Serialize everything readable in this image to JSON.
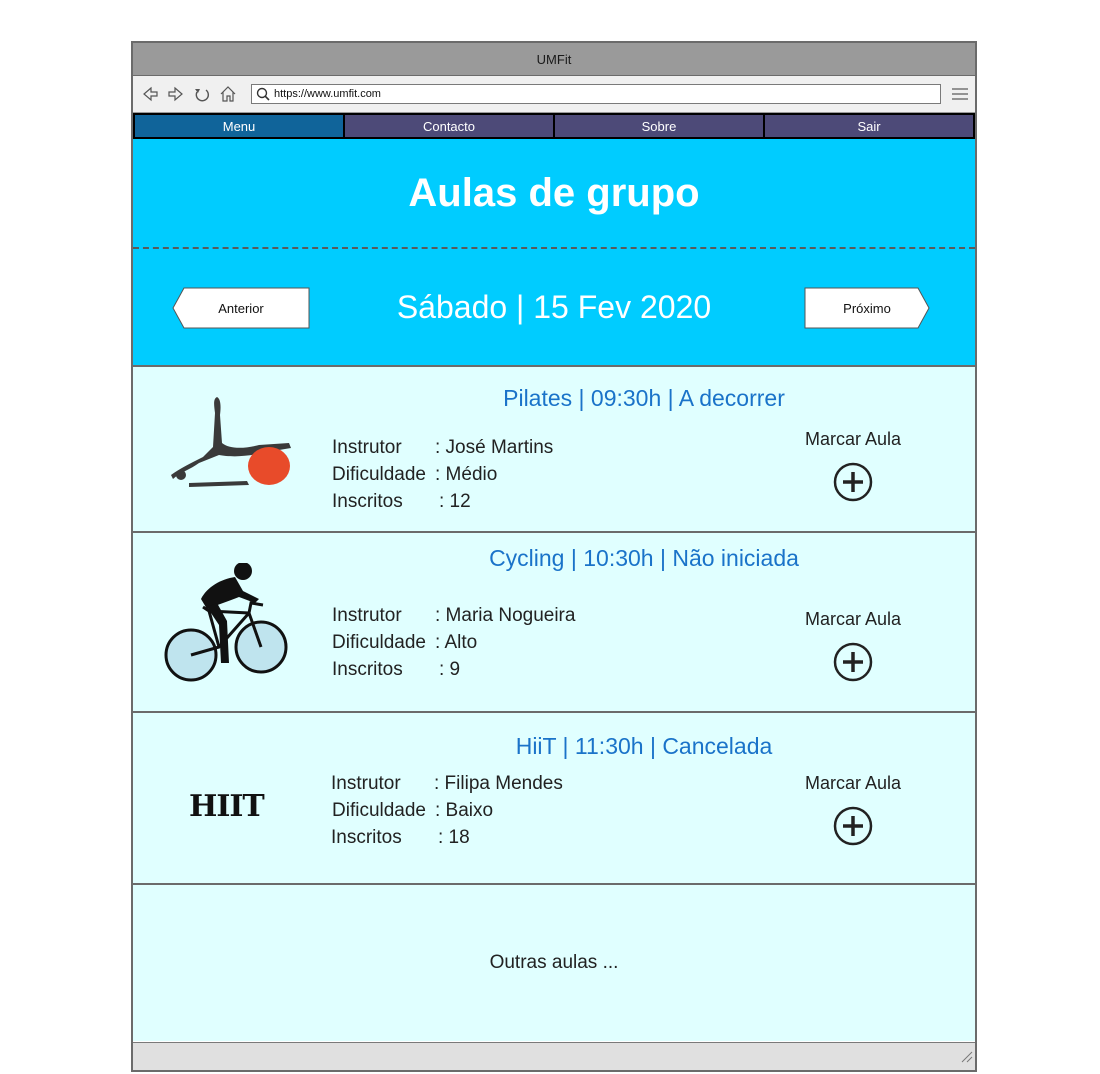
{
  "window": {
    "title": "UMFit"
  },
  "browser": {
    "url": "https://www.umfit.com"
  },
  "nav": {
    "items": [
      "Menu",
      "Contacto",
      "Sobre",
      "Sair"
    ]
  },
  "page": {
    "title": "Aulas de grupo",
    "date": "Sábado | 15 Fev 2020",
    "prev_label": "Anterior",
    "next_label": "Próximo"
  },
  "labels": {
    "instructor": "Instrutor",
    "difficulty": "Dificuldade",
    "enrolled": "Inscritos",
    "book": "Marcar Aula"
  },
  "classes": [
    {
      "title": "Pilates | 09:30h | A decorrer",
      "instructor": ": José Martins",
      "difficulty": ": Médio",
      "enrolled": ": 12",
      "icon": "pilates-icon"
    },
    {
      "title": "Cycling | 10:30h | Não iniciada",
      "instructor": ": Maria Nogueira",
      "difficulty": ": Alto",
      "enrolled": ": 9",
      "icon": "cycling-icon"
    },
    {
      "title": "HiiT | 11:30h | Cancelada",
      "instructor": ": Filipa Mendes",
      "difficulty": ": Baixo",
      "enrolled": ": 18",
      "icon": "hiit-logo",
      "logo_text": "HIIT"
    }
  ],
  "others": "Outras aulas ...",
  "colors": {
    "header": "#00ccff",
    "row_bg": "#e0ffff",
    "menu_active": "#10649a",
    "menu": "#4d4a78",
    "title_blue": "#1a73c9",
    "ball": "#e84b2a"
  }
}
